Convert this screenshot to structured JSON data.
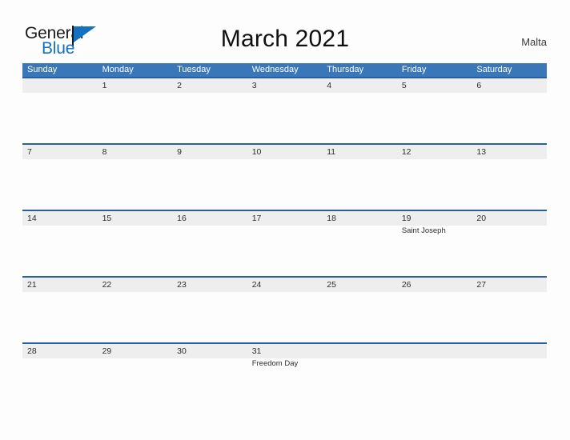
{
  "logo": {
    "word_one": "General",
    "word_two": "Blue",
    "flag_icon": "triangle-flag-icon",
    "brand_color": "#1272c0"
  },
  "header": {
    "title": "March 2021",
    "country": "Malta"
  },
  "theme": {
    "header_blue": "#3a77b8",
    "row_border_blue": "#2a5f9e",
    "band_gray": "#eeeeee",
    "text_dark": "#2e2e2e",
    "page_background": "#fdfdfd"
  },
  "calendar": {
    "month": "March",
    "year": "2021",
    "weekday_headers": [
      "Sunday",
      "Monday",
      "Tuesday",
      "Wednesday",
      "Thursday",
      "Friday",
      "Saturday"
    ],
    "weeks": [
      [
        {
          "day": "",
          "event": ""
        },
        {
          "day": "1",
          "event": ""
        },
        {
          "day": "2",
          "event": ""
        },
        {
          "day": "3",
          "event": ""
        },
        {
          "day": "4",
          "event": ""
        },
        {
          "day": "5",
          "event": ""
        },
        {
          "day": "6",
          "event": ""
        }
      ],
      [
        {
          "day": "7",
          "event": ""
        },
        {
          "day": "8",
          "event": ""
        },
        {
          "day": "9",
          "event": ""
        },
        {
          "day": "10",
          "event": ""
        },
        {
          "day": "11",
          "event": ""
        },
        {
          "day": "12",
          "event": ""
        },
        {
          "day": "13",
          "event": ""
        }
      ],
      [
        {
          "day": "14",
          "event": ""
        },
        {
          "day": "15",
          "event": ""
        },
        {
          "day": "16",
          "event": ""
        },
        {
          "day": "17",
          "event": ""
        },
        {
          "day": "18",
          "event": ""
        },
        {
          "day": "19",
          "event": "Saint Joseph"
        },
        {
          "day": "20",
          "event": ""
        }
      ],
      [
        {
          "day": "21",
          "event": ""
        },
        {
          "day": "22",
          "event": ""
        },
        {
          "day": "23",
          "event": ""
        },
        {
          "day": "24",
          "event": ""
        },
        {
          "day": "25",
          "event": ""
        },
        {
          "day": "26",
          "event": ""
        },
        {
          "day": "27",
          "event": ""
        }
      ],
      [
        {
          "day": "28",
          "event": ""
        },
        {
          "day": "29",
          "event": ""
        },
        {
          "day": "30",
          "event": ""
        },
        {
          "day": "31",
          "event": "Freedom Day"
        },
        {
          "day": "",
          "event": ""
        },
        {
          "day": "",
          "event": ""
        },
        {
          "day": "",
          "event": ""
        }
      ]
    ]
  }
}
